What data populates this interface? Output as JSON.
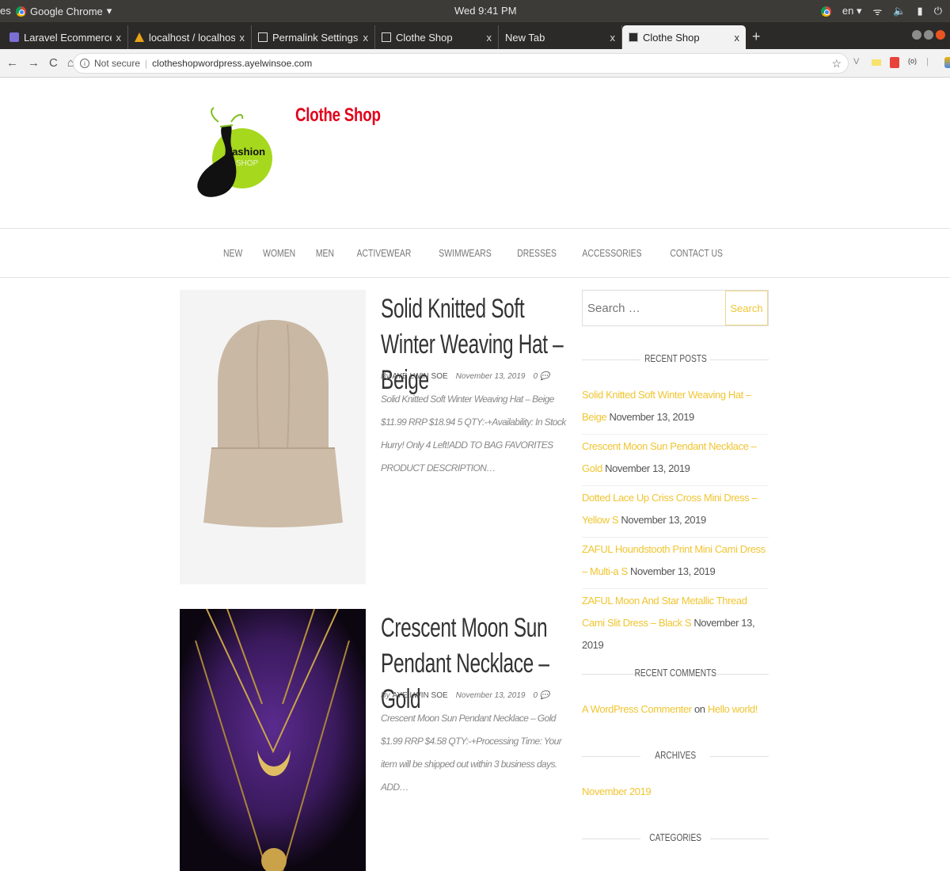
{
  "os": {
    "activities": "es",
    "app_name": "Google Chrome",
    "clock": "Wed  9:41 PM",
    "lang": "en"
  },
  "tabs": [
    {
      "title": "Laravel Ecommerce",
      "active": false
    },
    {
      "title": "localhost / localhost / lar",
      "active": false
    },
    {
      "title": "Permalink Settings ‹ Cloth",
      "active": false
    },
    {
      "title": "Clothe Shop",
      "active": false
    },
    {
      "title": "New Tab",
      "active": false
    },
    {
      "title": "Clothe Shop",
      "active": true
    }
  ],
  "address": {
    "security_label": "Not secure",
    "url": "clotheshopwordpress.ayelwinsoe.com"
  },
  "site": {
    "title": "Clothe Shop",
    "logo_text_1": "fashion",
    "logo_text_2": "SHOP",
    "nav": [
      "NEW",
      "WOMEN",
      "MEN",
      "ACTIVEWEAR",
      "SWIMWEARS",
      "DRESSES",
      "ACCESSORIES",
      "CONTACT US"
    ]
  },
  "posts": [
    {
      "title": "Solid Knitted Soft Winter Weaving Hat – Beige",
      "by": "By",
      "author": "AYE LWIN SOE",
      "date": "November 13, 2019",
      "comments": "0",
      "excerpt": "Solid Knitted Soft Winter Weaving Hat – Beige $11.99 RRP $18.94 5 QTY:-+Availability: In Stock Hurry! Only 4 Left!ADD TO BAG FAVORITES PRODUCT DESCRIPTION…"
    },
    {
      "title": "Crescent Moon Sun Pendant Necklace – Gold",
      "by": "By",
      "author": "AYE LWIN SOE",
      "date": "November 13, 2019",
      "comments": "0",
      "excerpt": "Crescent Moon Sun Pendant Necklace – Gold $1.99 RRP $4.58 QTY:-+Processing Time: Your item will be shipped out within 3 business days.  ADD…"
    }
  ],
  "sidebar": {
    "search_placeholder": "Search …",
    "search_button": "Search",
    "recent_posts_heading": "RECENT POSTS",
    "recent_posts": [
      {
        "link": "Solid Knitted Soft Winter Weaving Hat – Beige",
        "date": "November 13, 2019"
      },
      {
        "link": "Crescent Moon Sun Pendant Necklace – Gold",
        "date": "November 13, 2019"
      },
      {
        "link": "Dotted Lace Up Criss Cross Mini Dress – Yellow S",
        "date": "November 13, 2019"
      },
      {
        "link": "ZAFUL Houndstooth Print Mini Cami Dress – Multi-a S",
        "date": "November 13, 2019"
      },
      {
        "link": "ZAFUL Moon And Star Metallic Thread Cami Slit Dress – Black S",
        "date": "November 13, 2019"
      }
    ],
    "recent_comments_heading": "RECENT COMMENTS",
    "comment_author": "A WordPress Commenter",
    "comment_on": "on",
    "comment_post": "Hello world!",
    "archives_heading": "ARCHIVES",
    "archive_item": "November 2019",
    "categories_heading": "CATEGORIES"
  },
  "colors": {
    "title_red": "#e3001b",
    "link_yellow": "#f0c531",
    "logo_green": "#a6d81e"
  }
}
